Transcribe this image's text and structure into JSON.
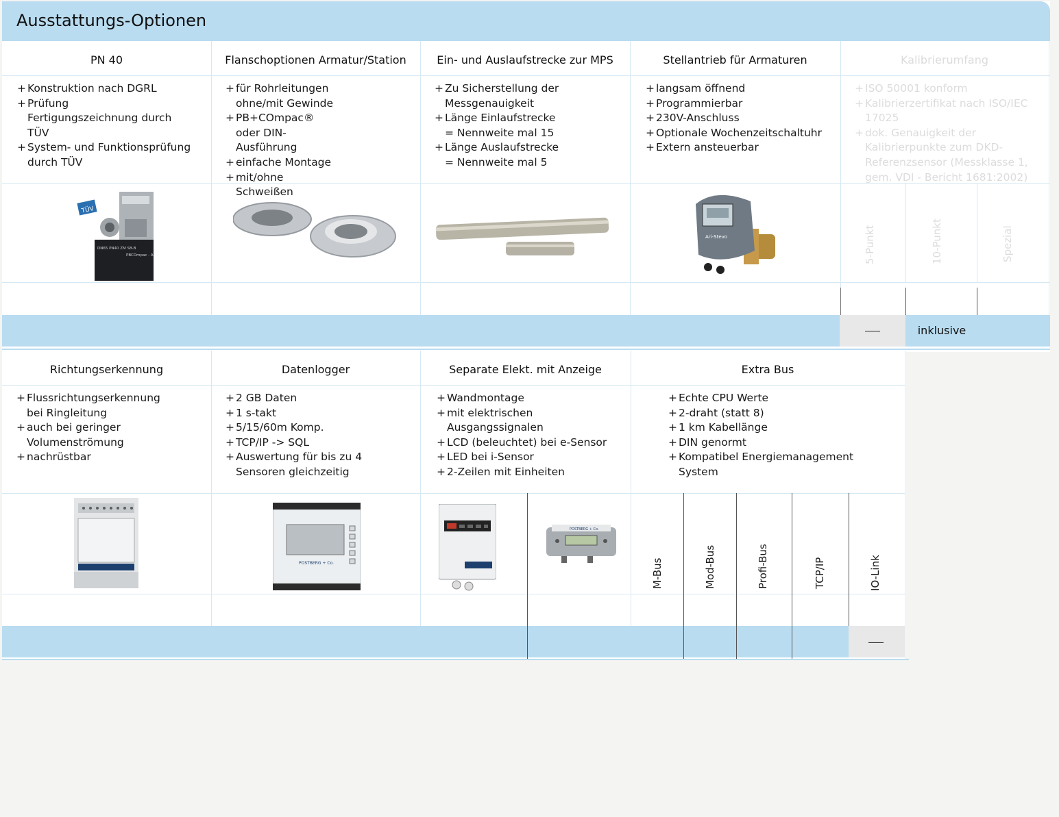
{
  "title": "Ausstattungs-Optionen",
  "top": {
    "columns": [
      {
        "header": "PN 40",
        "bullets": [
          "Konstruktion nach DGRL",
          "Prüfung Fertigungszeichnung durch TÜV",
          "System- und Funktionsprüfung durch TÜV"
        ]
      },
      {
        "header": "Flanschoptionen Armatur/Station",
        "bullets": [
          "für Rohrleitungen ohne/mit Gewinde",
          "PB+COmpac® oder DIN-Ausführung",
          "einfache Montage",
          "mit/ohne Schweißen"
        ]
      },
      {
        "header": "Ein- und Auslaufstrecke zur MPS",
        "bullets": [
          "Zu Sicherstellung der Messgenauigkeit",
          "Länge Einlaufstrecke = Nennweite mal 15",
          "Länge Auslaufstrecke = Nennweite mal 5"
        ]
      },
      {
        "header": "Stellantrieb für Armaturen",
        "bullets": [
          "langsam öffnend",
          "Programmierbar",
          "230V-Anschluss",
          "Optionale Wochenzeitschaltuhr",
          "Extern ansteuerbar"
        ]
      },
      {
        "header": "Kalibrierumfang",
        "bullets": [
          "ISO 50001 konform",
          "Kalibrierzertifikat nach ISO/IEC 17025",
          "dok. Genauigkeit der Kalibrierpunkte zum DKD-Referenzsensor (Messklasse 1, gem. VDI - Bericht 1681:2002)"
        ]
      }
    ],
    "kalibrier_options": [
      "5-Punkt",
      "10-Punkt",
      "Spezial"
    ],
    "kalibrier_values": [
      "—",
      "inklusive"
    ],
    "tuv_label": "TÜV",
    "pn40_label_line1": "DN65 PN40 ZM SB-B",
    "pn40_label_line2": "PBCOmpac - A",
    "actuator_brand": "Ari-Stevo"
  },
  "bottom": {
    "columns": [
      {
        "header": "Richtungserkennung",
        "bullets": [
          "Flussrichtungserkennung bei Ringleitung",
          "auch bei geringer Volumenströmung",
          "nachrüstbar"
        ]
      },
      {
        "header": "Datenlogger",
        "bullets": [
          "2 GB Daten",
          "1 s-takt",
          "5/15/60m Komp.",
          "TCP/IP -> SQL",
          "Auswertung für bis zu 4 Sensoren gleichzeitig"
        ]
      },
      {
        "header": "Separate Elekt. mit Anzeige",
        "bullets": [
          "Wandmontage",
          "mit elektrischen Ausgangssignalen",
          "LCD (beleuchtet) bei e-Sensor",
          "LED bei i-Sensor",
          "2-Zeilen mit Einheiten"
        ]
      },
      {
        "header": "Extra Bus",
        "bullets": [
          "Echte CPU Werte",
          "2-draht (statt 8)",
          "1 km Kabellänge",
          "DIN genormt",
          "Kompatibel Energiemanagement System"
        ]
      }
    ],
    "bus_options": [
      "M-Bus",
      "Mod-Bus",
      "Profi-Bus",
      "TCP/IP",
      "IO-Link"
    ],
    "iolink_value": "—",
    "logger_brand": "POSTBERG + Co.",
    "display_brand": "POSTBERG + Co."
  },
  "colors": {
    "band": "#b9dcf0",
    "grid": "#d6e8f3",
    "grey": "#e8e8e8"
  }
}
